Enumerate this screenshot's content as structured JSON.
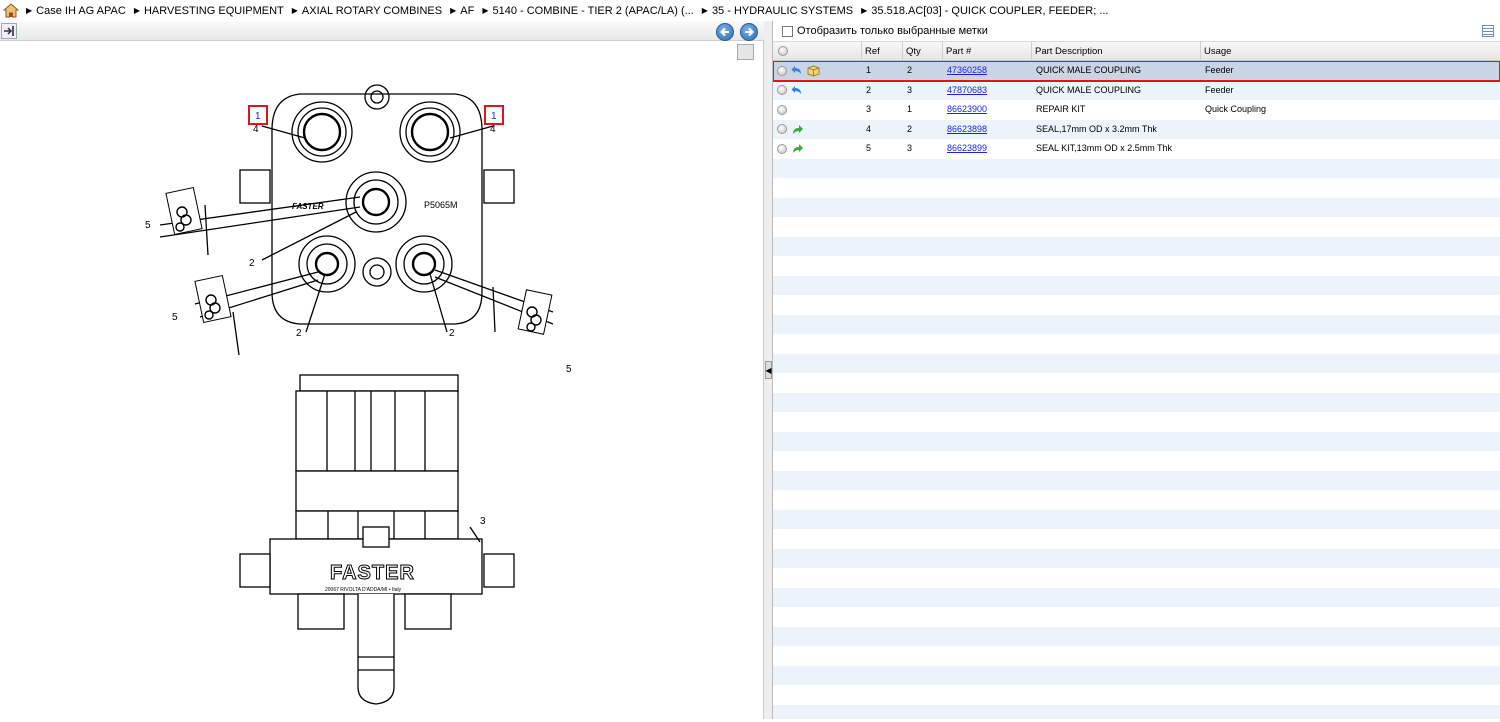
{
  "breadcrumb": [
    "Case IH AG APAC",
    "HARVESTING EQUIPMENT",
    "AXIAL ROTARY COMBINES",
    "AF",
    "5140 - COMBINE - TIER 2 (APAC/LA) (...",
    "35 - HYDRAULIC SYSTEMS",
    "35.518.AC[03] - QUICK COUPLER, FEEDER; ..."
  ],
  "filter": {
    "label": "Отобразить только выбранные метки"
  },
  "grid": {
    "columns": [
      "Ref",
      "Qty",
      "Part #",
      "Part Description",
      "Usage"
    ],
    "rows": [
      {
        "ref": "1",
        "qty": "2",
        "part": "47360258",
        "desc": "QUICK MALE COUPLING",
        "usage": "Feeder",
        "icons": [
          "return-arrow-icon",
          "package-icon"
        ]
      },
      {
        "ref": "2",
        "qty": "3",
        "part": "47870683",
        "desc": "QUICK MALE COUPLING",
        "usage": "Feeder",
        "icons": [
          "return-arrow-icon"
        ]
      },
      {
        "ref": "3",
        "qty": "1",
        "part": "86623900",
        "desc": "REPAIR KIT",
        "usage": "Quick Coupling",
        "icons": []
      },
      {
        "ref": "4",
        "qty": "2",
        "part": "86623898",
        "desc": "SEAL,17mm OD x 3.2mm Thk",
        "usage": "",
        "icons": [
          "green-arrow-icon"
        ]
      },
      {
        "ref": "5",
        "qty": "3",
        "part": "86623899",
        "desc": "SEAL KIT,13mm OD x 2.5mm Thk",
        "usage": "",
        "icons": [
          "green-arrow-icon"
        ]
      }
    ]
  },
  "drawing": {
    "callouts": [
      "1",
      "1",
      "4",
      "4",
      "5",
      "5",
      "5",
      "2",
      "2",
      "2",
      "3"
    ],
    "model": "P5065M",
    "brand": "FASTER",
    "brand_sub": "20067 RIVOLTA D'ADDA/MI • Italy"
  }
}
